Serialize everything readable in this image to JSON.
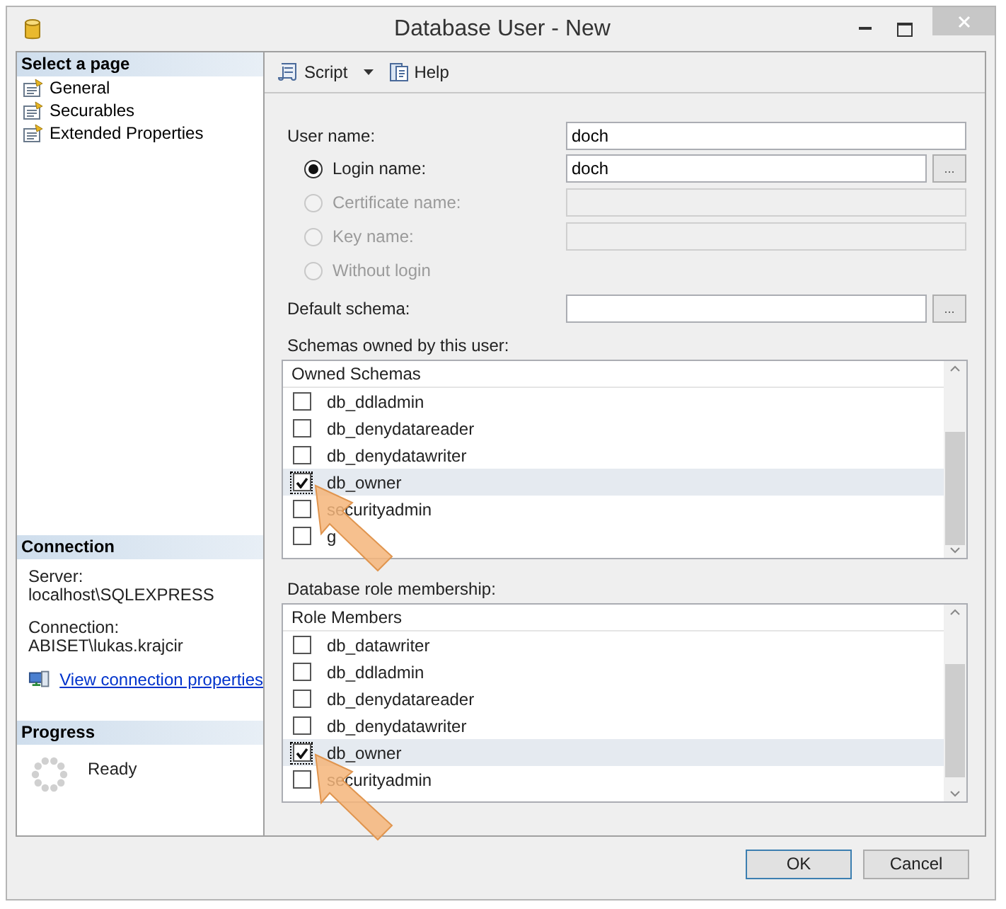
{
  "window": {
    "title": "Database User - New"
  },
  "sidebar": {
    "header": "Select a page",
    "pages": [
      {
        "label": "General"
      },
      {
        "label": "Securables"
      },
      {
        "label": "Extended Properties"
      }
    ]
  },
  "connection": {
    "header": "Connection",
    "server_label": "Server:",
    "server": "localhost\\SQLEXPRESS",
    "connection_label": "Connection:",
    "connection": "ABISET\\lukas.krajcir",
    "link": "View connection properties"
  },
  "progress": {
    "header": "Progress",
    "status": "Ready"
  },
  "toolbar": [
    {
      "label": "Script",
      "kind": "dropdown"
    },
    {
      "label": "Help",
      "kind": "button"
    }
  ],
  "form": {
    "user_name": {
      "label": "User name:",
      "value": "doch"
    },
    "options": [
      {
        "label": "Login name:",
        "selected": true,
        "disabled": false,
        "kind": "browse",
        "value": "doch",
        "browse": "..."
      },
      {
        "label": "Certificate name:",
        "selected": false,
        "disabled": true,
        "kind": "field"
      },
      {
        "label": "Key name:",
        "selected": false,
        "disabled": true,
        "kind": "field"
      },
      {
        "label": "Without login",
        "selected": false,
        "disabled": true,
        "kind": "none"
      }
    ],
    "default_schema": {
      "label": "Default schema:",
      "browse": "..."
    }
  },
  "lists": [
    {
      "label": "Schemas owned by this user:",
      "column": "Owned Schemas",
      "rows": [
        {
          "name": "db_ddladmin",
          "checked": false,
          "selected": false
        },
        {
          "name": "db_denydatareader",
          "checked": false,
          "selected": false
        },
        {
          "name": "db_denydatawriter",
          "checked": false,
          "selected": false
        },
        {
          "name": "db_owner",
          "checked": true,
          "selected": true
        },
        {
          "name": "securityadmin",
          "checked": false,
          "selected": false
        },
        {
          "name": "g",
          "checked": false,
          "selected": false
        }
      ]
    },
    {
      "label": "Database role membership:",
      "column": "Role Members",
      "rows": [
        {
          "name": "db_datawriter",
          "checked": false,
          "selected": false
        },
        {
          "name": "db_ddladmin",
          "checked": false,
          "selected": false
        },
        {
          "name": "db_denydatareader",
          "checked": false,
          "selected": false
        },
        {
          "name": "db_denydatawriter",
          "checked": false,
          "selected": false
        },
        {
          "name": "db_owner",
          "checked": true,
          "selected": true
        },
        {
          "name": "securityadmin",
          "checked": false,
          "selected": false
        }
      ]
    }
  ],
  "buttons": [
    {
      "label": "OK",
      "default": true
    },
    {
      "label": "Cancel",
      "default": false
    }
  ]
}
